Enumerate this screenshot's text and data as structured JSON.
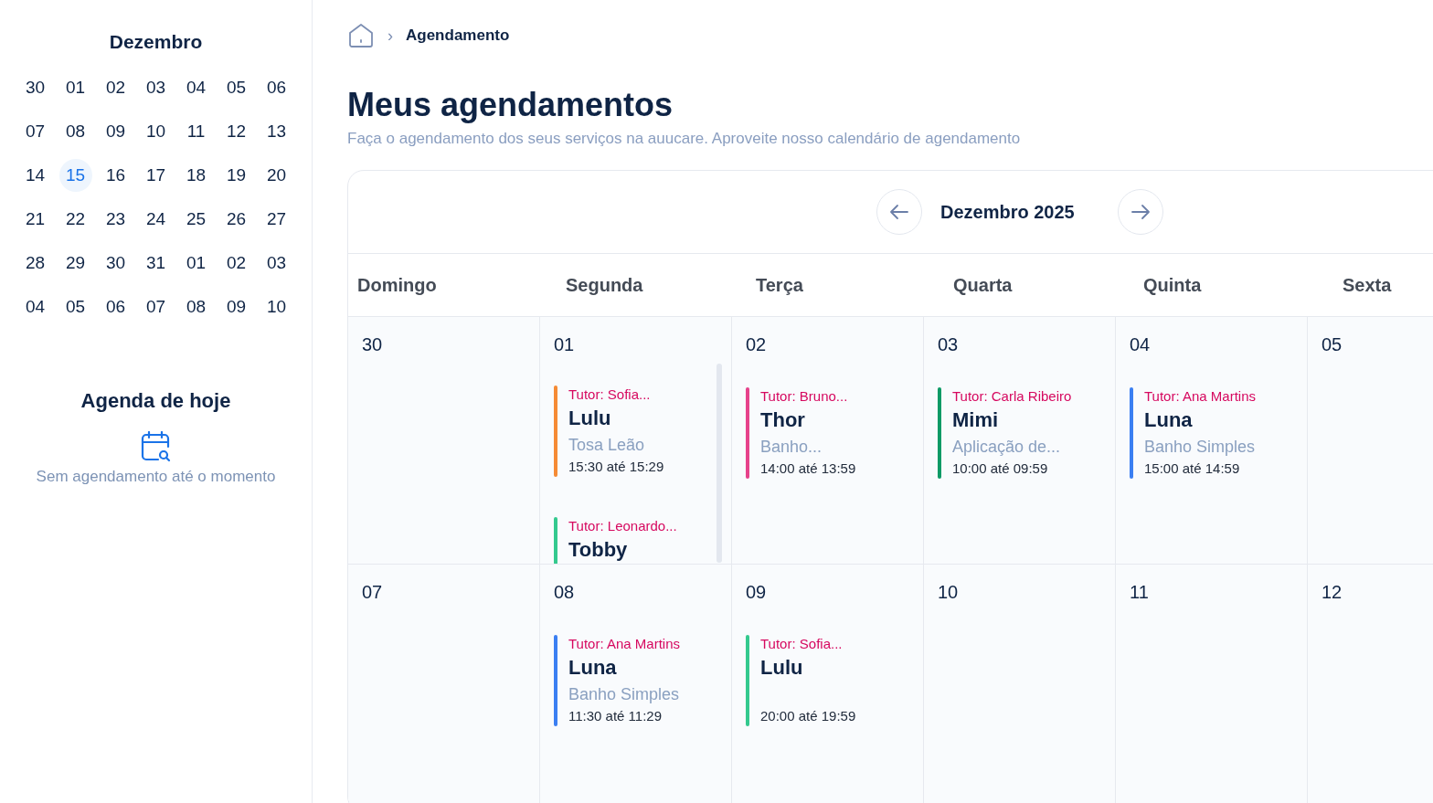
{
  "mini_calendar": {
    "month": "Dezembro",
    "weeks": [
      [
        {
          "label": "30",
          "selected": false
        },
        {
          "label": "01",
          "selected": false
        },
        {
          "label": "02",
          "selected": false
        },
        {
          "label": "03",
          "selected": false
        },
        {
          "label": "04",
          "selected": false
        },
        {
          "label": "05",
          "selected": false
        },
        {
          "label": "06",
          "selected": false
        }
      ],
      [
        {
          "label": "07",
          "selected": false
        },
        {
          "label": "08",
          "selected": false
        },
        {
          "label": "09",
          "selected": false
        },
        {
          "label": "10",
          "selected": false
        },
        {
          "label": "11",
          "selected": false
        },
        {
          "label": "12",
          "selected": false
        },
        {
          "label": "13",
          "selected": false
        }
      ],
      [
        {
          "label": "14",
          "selected": false
        },
        {
          "label": "15",
          "selected": true
        },
        {
          "label": "16",
          "selected": false
        },
        {
          "label": "17",
          "selected": false
        },
        {
          "label": "18",
          "selected": false
        },
        {
          "label": "19",
          "selected": false
        },
        {
          "label": "20",
          "selected": false
        }
      ],
      [
        {
          "label": "21",
          "selected": false
        },
        {
          "label": "22",
          "selected": false
        },
        {
          "label": "23",
          "selected": false
        },
        {
          "label": "24",
          "selected": false
        },
        {
          "label": "25",
          "selected": false
        },
        {
          "label": "26",
          "selected": false
        },
        {
          "label": "27",
          "selected": false
        }
      ],
      [
        {
          "label": "28",
          "selected": false
        },
        {
          "label": "29",
          "selected": false
        },
        {
          "label": "30",
          "selected": false
        },
        {
          "label": "31",
          "selected": false
        },
        {
          "label": "01",
          "selected": false
        },
        {
          "label": "02",
          "selected": false
        },
        {
          "label": "03",
          "selected": false
        }
      ],
      [
        {
          "label": "04",
          "selected": false
        },
        {
          "label": "05",
          "selected": false
        },
        {
          "label": "06",
          "selected": false
        },
        {
          "label": "07",
          "selected": false
        },
        {
          "label": "08",
          "selected": false
        },
        {
          "label": "09",
          "selected": false
        },
        {
          "label": "10",
          "selected": false
        }
      ]
    ]
  },
  "today_agenda": {
    "title": "Agenda de hoje",
    "empty_message": "Sem agendamento até o momento"
  },
  "breadcrumb": {
    "current": "Agendamento",
    "separator": "›"
  },
  "page_title": "Meus agendamentos",
  "page_subtitle": "Faça o agendamento dos seus serviços na auucare. Aproveite nosso calendário de agendamento",
  "calendar": {
    "month_label": "Dezembro 2025",
    "weekdays": [
      "Domingo",
      "Segunda",
      "Terça",
      "Quarta",
      "Quinta",
      "Sexta"
    ],
    "weeks": [
      [
        {
          "day": "30"
        },
        {
          "day": "01",
          "events": [
            {
              "tutor": "Tutor: Sofia...",
              "pet": "Lulu",
              "service": "Tosa Leão",
              "time": "15:30 até 15:29",
              "color": "#f58b35"
            },
            {
              "tutor": "Tutor: Leonardo...",
              "pet": "Tobby",
              "color": "#34c98e"
            }
          ]
        },
        {
          "day": "02",
          "events": [
            {
              "tutor": "Tutor: Bruno...",
              "pet": "Thor",
              "service": "Banho...",
              "time": "14:00 até 13:59",
              "color": "#e6428b"
            }
          ]
        },
        {
          "day": "03",
          "events": [
            {
              "tutor": "Tutor: Carla Ribeiro",
              "pet": "Mimi",
              "service": "Aplicação de...",
              "time": "10:00 até 09:59",
              "color": "#0e9a66"
            }
          ]
        },
        {
          "day": "04",
          "events": [
            {
              "tutor": "Tutor: Ana Martins",
              "pet": "Luna",
              "service": "Banho Simples",
              "time": "15:00 até 14:59",
              "color": "#3b7ff2"
            }
          ]
        },
        {
          "day": "05"
        }
      ],
      [
        {
          "day": "07"
        },
        {
          "day": "08",
          "events": [
            {
              "tutor": "Tutor: Ana Martins",
              "pet": "Luna",
              "service": "Banho Simples",
              "time": "11:30 até 11:29",
              "color": "#3b7ff2"
            }
          ]
        },
        {
          "day": "09",
          "events": [
            {
              "tutor": "Tutor: Sofia...",
              "pet": "Lulu",
              "time": "20:00 até 19:59",
              "color": "#34c98e"
            }
          ]
        },
        {
          "day": "10"
        },
        {
          "day": "11"
        },
        {
          "day": "12"
        }
      ]
    ]
  }
}
